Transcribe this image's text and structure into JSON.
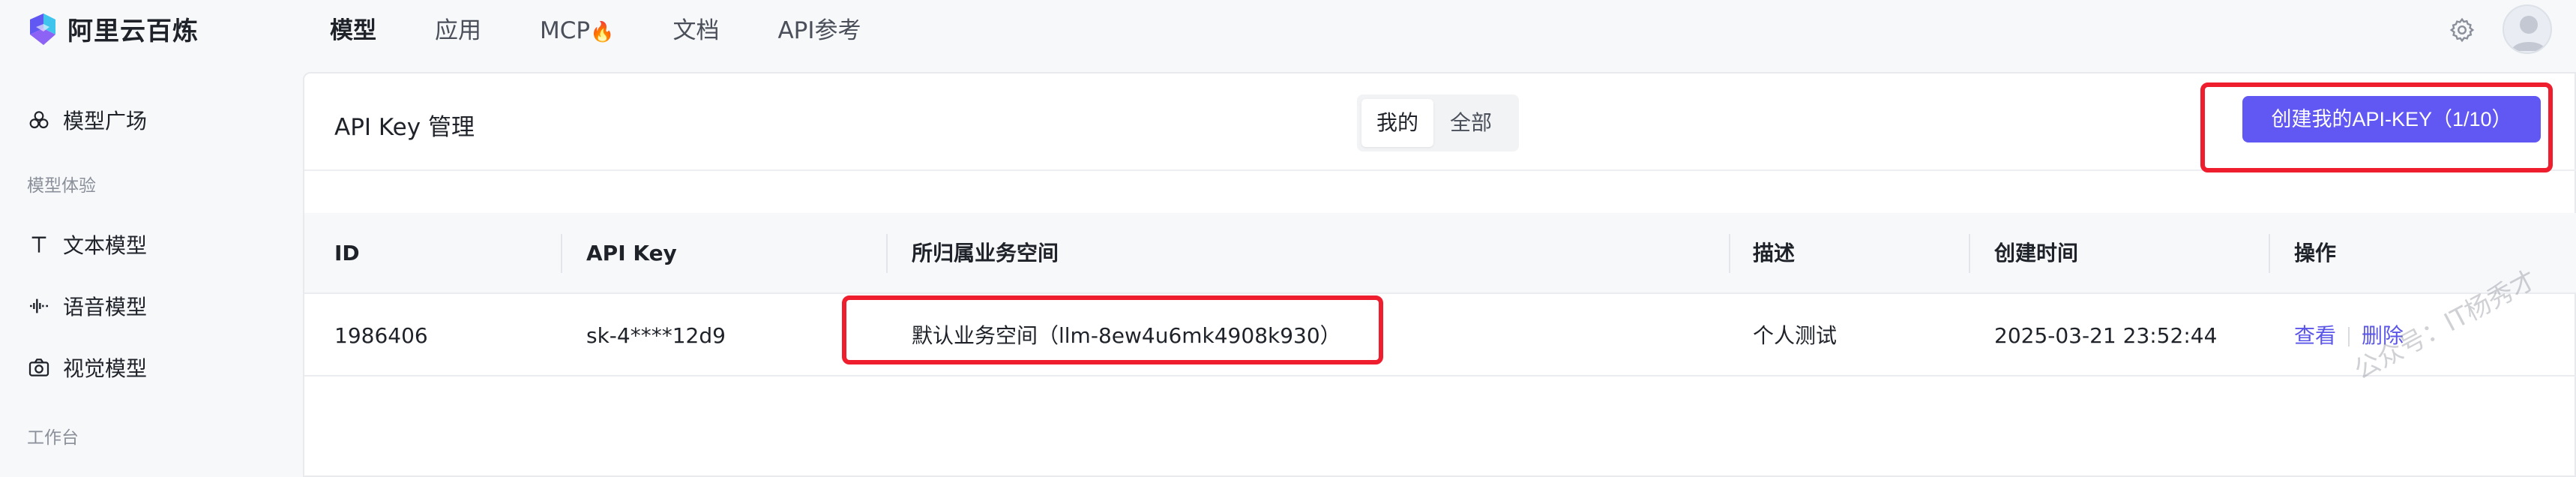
{
  "brand": {
    "name": "阿里云百炼"
  },
  "nav": {
    "items": [
      {
        "label": "模型",
        "active": true
      },
      {
        "label": "应用",
        "active": false
      },
      {
        "label": "MCP",
        "suffix": "🔥",
        "active": false
      },
      {
        "label": "文档",
        "active": false
      },
      {
        "label": "API参考",
        "active": false
      }
    ]
  },
  "sidebar": {
    "model_square": "模型广场",
    "group_experience": "模型体验",
    "text_model": "文本模型",
    "speech_model": "语音模型",
    "vision_model": "视觉模型",
    "group_workbench": "工作台"
  },
  "panel": {
    "title": "API Key 管理",
    "segment": {
      "mine": "我的",
      "all": "全部",
      "selected": "我的"
    },
    "create_button": "创建我的API-KEY（1/10）"
  },
  "table": {
    "headers": [
      "ID",
      "API Key",
      "所归属业务空间",
      "描述",
      "创建时间",
      "操作"
    ],
    "rows": [
      {
        "id": "1986406",
        "api_key": "sk-4****12d9",
        "workspace": "默认业务空间（llm-8ew4u6mk4908k930）",
        "description": "个人测试",
        "created_at": "2025-03-21 23:52:44",
        "actions": [
          "查看",
          "删除"
        ]
      }
    ]
  },
  "watermark": "公众号：IT杨秀才",
  "colors": {
    "accent": "#6157f2",
    "link": "#5b56e8",
    "highlight": "#ee1e2e"
  }
}
